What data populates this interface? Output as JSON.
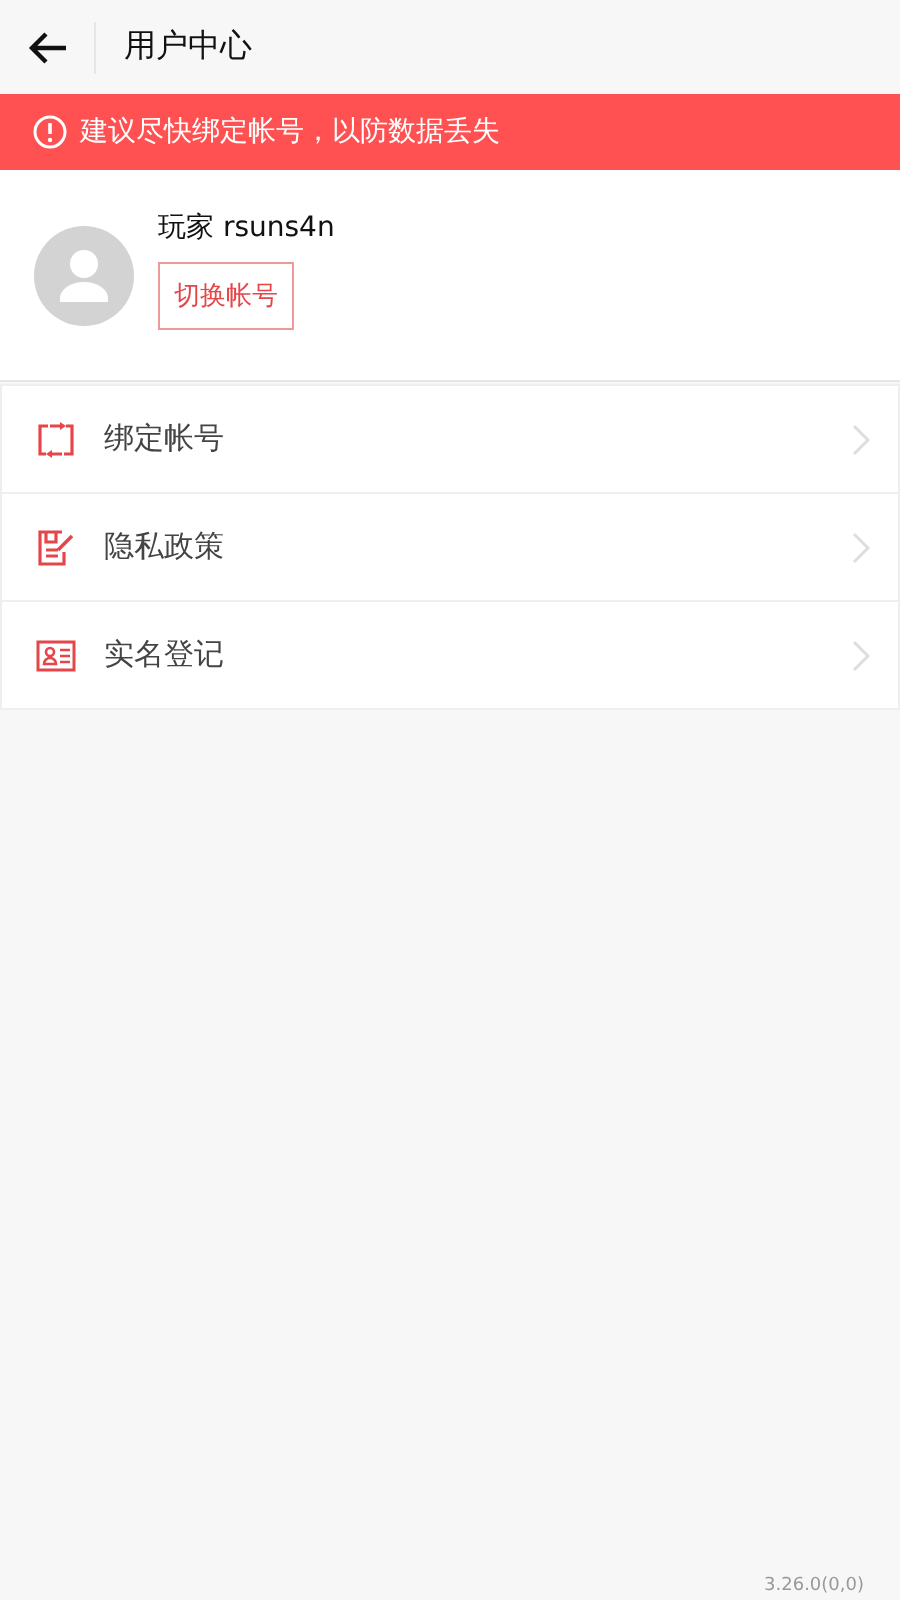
{
  "header": {
    "title": "用户中心"
  },
  "notice": {
    "text": "建议尽快绑定帐号，以防数据丢失"
  },
  "profile": {
    "name": "玩家 rsuns4n",
    "switch_button": "切换帐号"
  },
  "menu": [
    {
      "kind": "bind",
      "label": "绑定帐号"
    },
    {
      "kind": "privacy",
      "label": "隐私政策"
    },
    {
      "kind": "realname",
      "label": "实名登记"
    }
  ],
  "version": "3.26.0(0,0)"
}
